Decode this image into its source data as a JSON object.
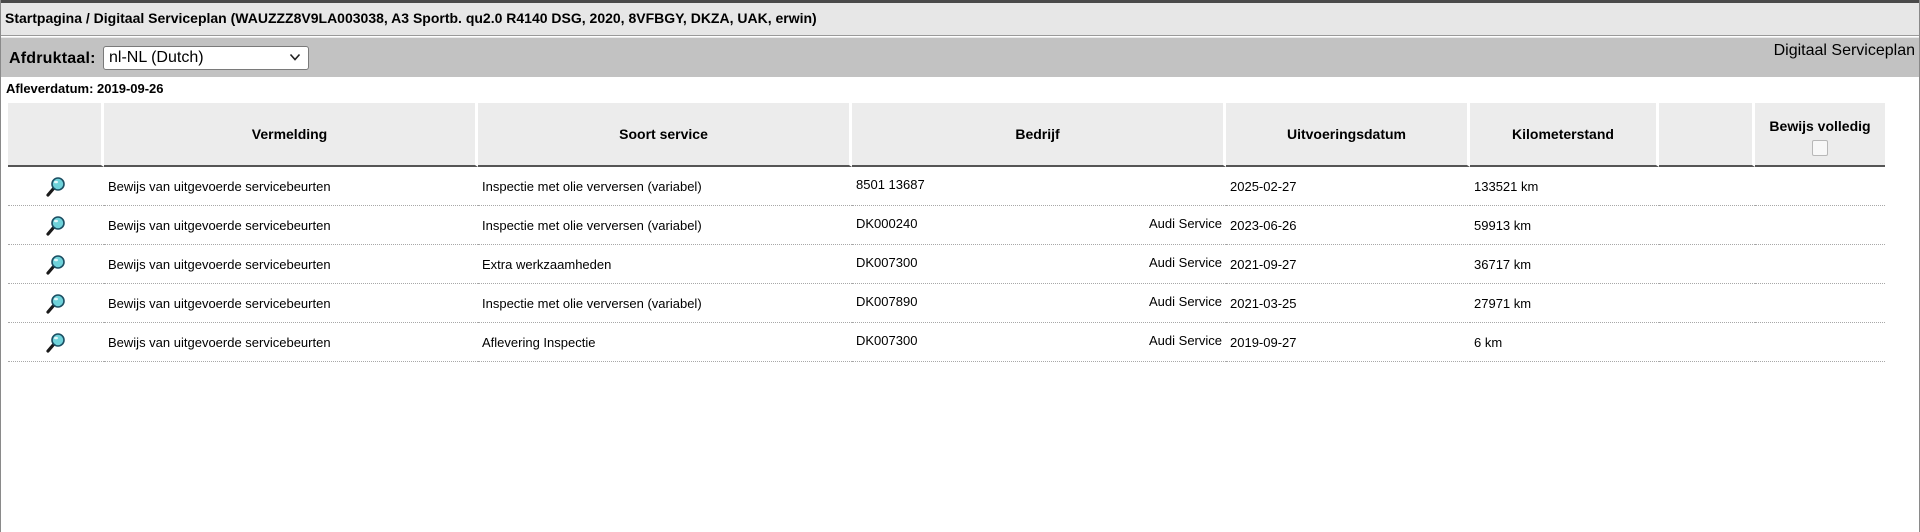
{
  "breadcrumb": "Startpagina / Digitaal Serviceplan (WAUZZZ8V9LA003038, A3 Sportb. qu2.0 R4140 DSG, 2020, 8VFBGY, DKZA, UAK, erwin)",
  "toolbar": {
    "print_language_label": "Afdruktaal:",
    "print_language_value": "nl-NL (Dutch)",
    "page_heading": "Digitaal Serviceplan"
  },
  "delivery_date": "Afleverdatum: 2019-09-26",
  "table": {
    "headers": {
      "entry": "Vermelding",
      "service_type": "Soort service",
      "company": "Bedrijf",
      "execution_date": "Uitvoeringsdatum",
      "mileage": "Kilometerstand",
      "proof_complete": "Bewijs volledig"
    },
    "rows": [
      {
        "entry": "Bewijs van uitgevoerde servicebeurten",
        "service_type": "Inspectie met olie verversen (variabel)",
        "company_code": "8501 13687",
        "company_name": "",
        "execution_date": "2025-02-27",
        "mileage": "133521 km"
      },
      {
        "entry": "Bewijs van uitgevoerde servicebeurten",
        "service_type": "Inspectie met olie verversen (variabel)",
        "company_code": "DK000240",
        "company_name": "Audi Service",
        "execution_date": "2023-06-26",
        "mileage": "59913 km"
      },
      {
        "entry": "Bewijs van uitgevoerde servicebeurten",
        "service_type": "Extra werkzaamheden",
        "company_code": "DK007300",
        "company_name": "Audi Service",
        "execution_date": "2021-09-27",
        "mileage": "36717 km"
      },
      {
        "entry": "Bewijs van uitgevoerde servicebeurten",
        "service_type": "Inspectie met olie verversen (variabel)",
        "company_code": "DK007890",
        "company_name": "Audi Service",
        "execution_date": "2021-03-25",
        "mileage": "27971 km"
      },
      {
        "entry": "Bewijs van uitgevoerde servicebeurten",
        "service_type": "Aflevering Inspectie",
        "company_code": "DK007300",
        "company_name": "Audi Service",
        "execution_date": "2019-09-27",
        "mileage": "6 km"
      }
    ]
  },
  "icons": {
    "row_action": "magnifier-icon",
    "select_arrow": "chevron-down-icon"
  },
  "colors": {
    "breadcrumb_bg": "#e7e7e7",
    "toolbar_bg": "#c2c2c2",
    "header_bg": "#ececec",
    "magnifier_lens": "#6fd2da"
  }
}
